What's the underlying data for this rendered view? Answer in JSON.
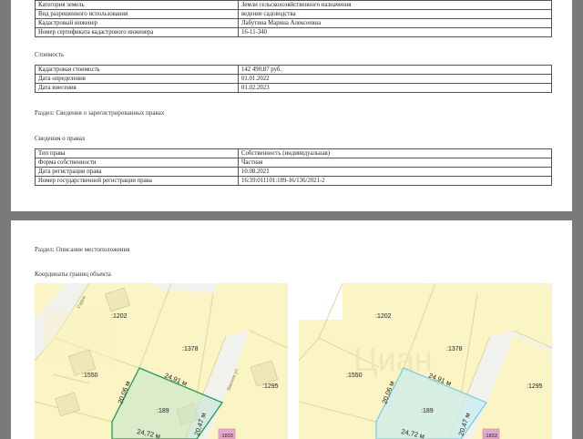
{
  "land_info": {
    "rows": [
      {
        "label": "Категория земель",
        "value": "Земли сельскохозяйственного назначения"
      },
      {
        "label": "Вид разрешенного использования",
        "value": "ведение садоводства"
      },
      {
        "label": "Кадастровый инженер",
        "value": "Лабутина Марина Алексеевна"
      },
      {
        "label": "Номер сертификата кадастрового инженера",
        "value": "16-11-340"
      }
    ]
  },
  "cost": {
    "heading": "Стоимость",
    "rows": [
      {
        "label": "Кадастровая стоимость",
        "value": "142 490,87 руб."
      },
      {
        "label": "Дата определения",
        "value": "01.01.2022"
      },
      {
        "label": "Дата внесения",
        "value": "01.02.2023"
      }
    ]
  },
  "rights_section_title": "Раздел: Сведения о зарегистрированных правах",
  "rights": {
    "heading": "Сведения о правах",
    "rows": [
      {
        "label": "Тип права",
        "value": "Собственность (индивидуальная)"
      },
      {
        "label": "Форма собственности",
        "value": "Частная"
      },
      {
        "label": "Дата регистрации права",
        "value": "10.08.2021"
      },
      {
        "label": "Номер государственной регистрации права",
        "value": "16:39:011101:189-16/136/2021-2"
      }
    ]
  },
  "location_section_title": "Раздел: Описание местоположения",
  "coords_heading": "Координаты границ объекта",
  "map": {
    "parcels": {
      "p1202": ":1202",
      "p1378": ":1378",
      "p1550": ":1550",
      "p1295": ":1295",
      "p189": ":189",
      "p1833": ":1833"
    },
    "dims": {
      "top": "24,91 м",
      "left": "20,06 м",
      "right": "20,47 м",
      "bottom": "24,72 м"
    },
    "streets": [
      "Садов",
      "Вишнев ул."
    ],
    "watermark": "Циан",
    "colors": {
      "parcel_fill": "#fbf4c4",
      "road": "#f1f1ee",
      "line": "#e0d69a",
      "highlight_left": "#1aa051",
      "highlight_right": "#7ccfd8"
    }
  }
}
